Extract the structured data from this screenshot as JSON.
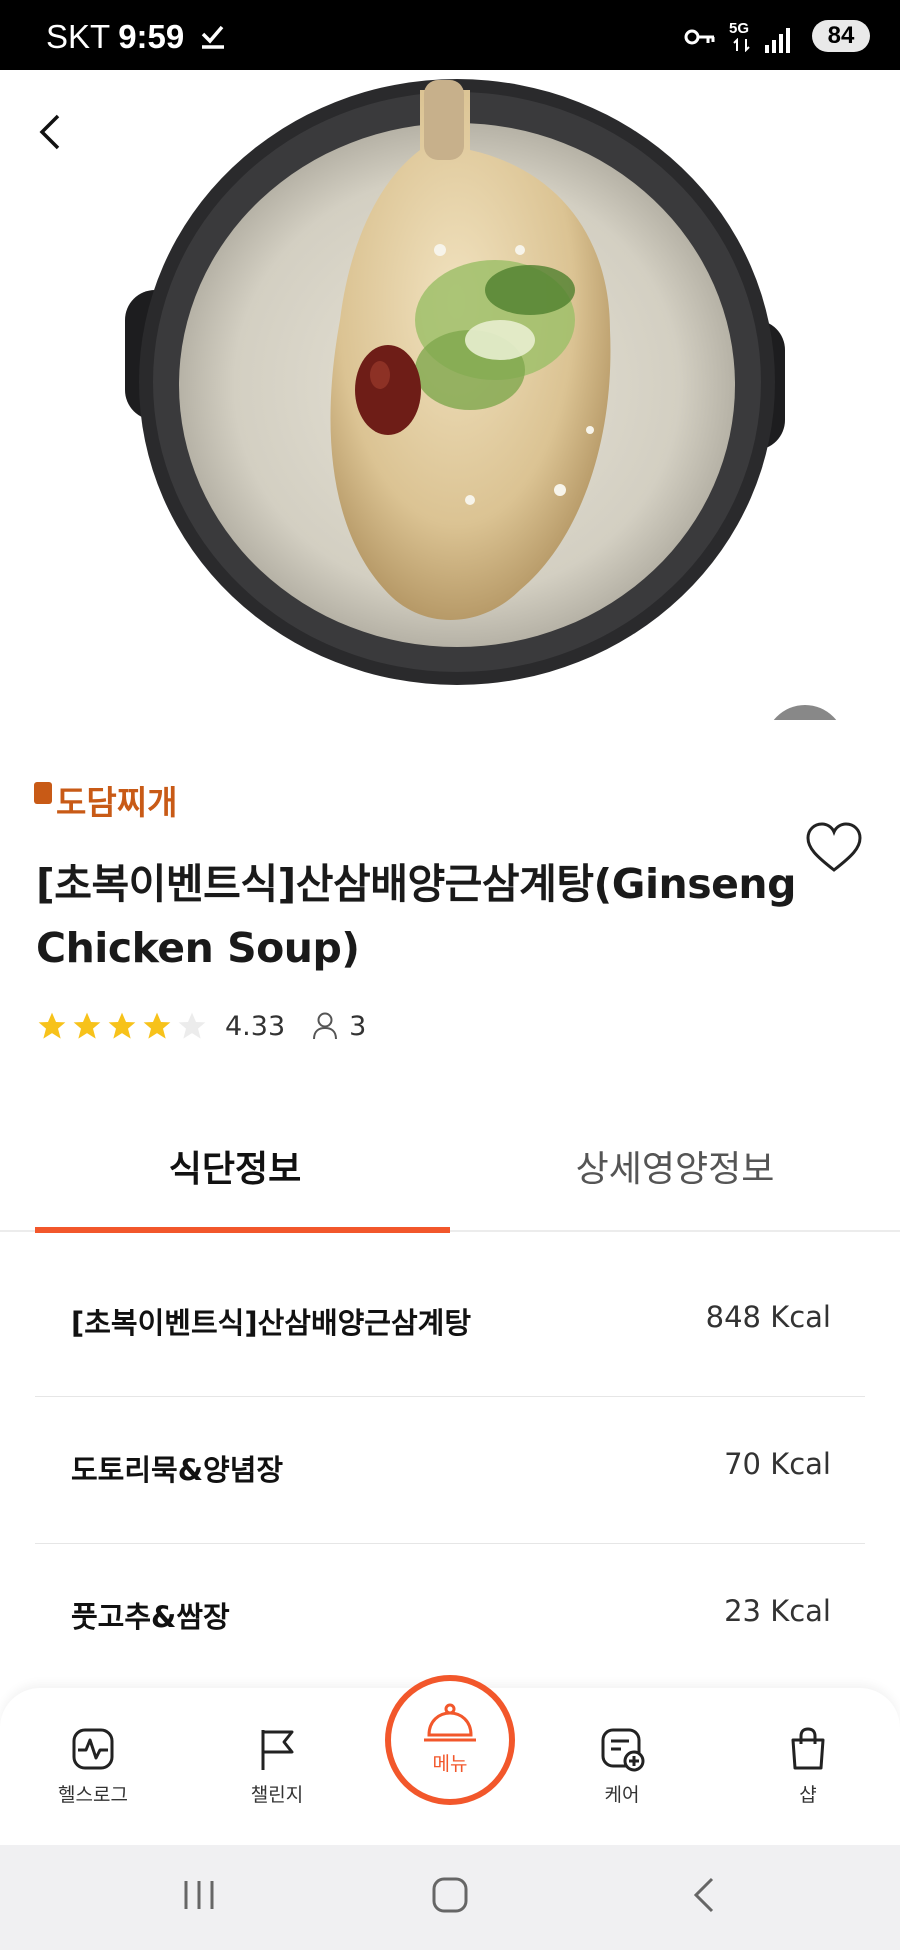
{
  "status_bar": {
    "carrier": "SKT",
    "time": "9:59",
    "network": "5G",
    "battery": "84"
  },
  "brand": {
    "logo_text": "도담찌개"
  },
  "product": {
    "title": "[초복이벤트식]산삼배양근삼계탕(Ginseng Chicken Soup)",
    "rating": 4.33,
    "rating_text": "4.33",
    "reviewer_count": "3"
  },
  "tabs": [
    {
      "label": "식단정보",
      "active": true
    },
    {
      "label": "상세영양정보",
      "active": false
    }
  ],
  "menu_items": [
    {
      "name": "[초복이벤트식]산삼배양근삼계탕",
      "kcal": "848 Kcal"
    },
    {
      "name": "도토리묵&양념장",
      "kcal": "70 Kcal"
    },
    {
      "name": "풋고추&쌈장",
      "kcal": "23 Kcal"
    }
  ],
  "bottom_nav": [
    {
      "label": "헬스로그",
      "icon": "health-log-icon"
    },
    {
      "label": "챌린지",
      "icon": "flag-icon"
    },
    {
      "label": "메뉴",
      "icon": "cloche-icon",
      "active": true
    },
    {
      "label": "케어",
      "icon": "care-icon"
    },
    {
      "label": "샵",
      "icon": "shopping-bag-icon"
    }
  ],
  "colors": {
    "accent": "#f2572b",
    "star": "#f7c21a"
  }
}
